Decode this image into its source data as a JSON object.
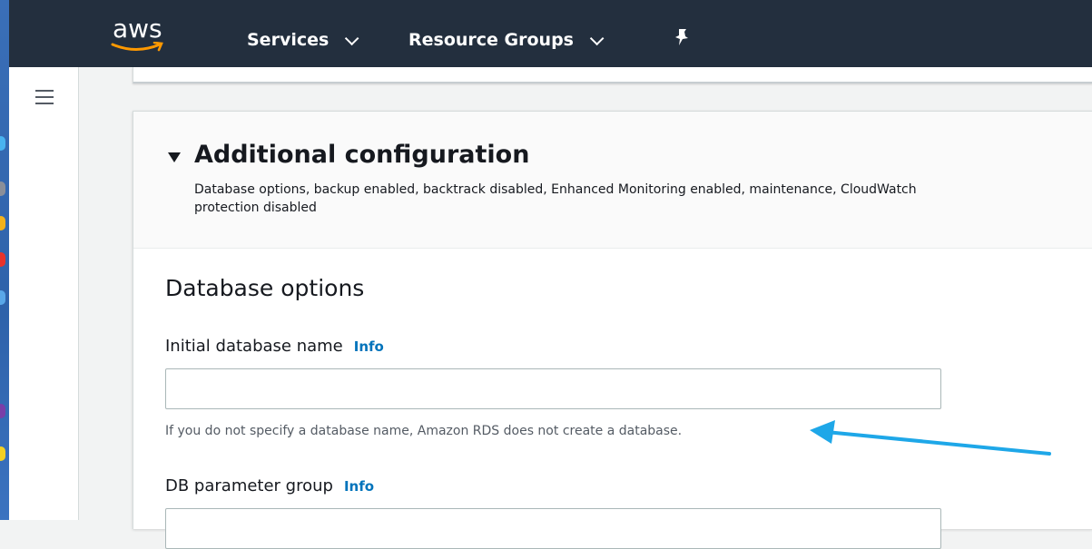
{
  "topnav": {
    "logo_text": "aws",
    "services_label": "Services",
    "resource_groups_label": "Resource Groups",
    "bg_color": "#232f3e"
  },
  "additional_config": {
    "title": "Additional configuration",
    "description_line1": "Database options, backup enabled, backtrack disabled, Enhanced Monitoring enabled, maintenance, CloudWatch",
    "description_line2": "protection disabled"
  },
  "database_options": {
    "title": "Database options",
    "initial_db_name": {
      "label": "Initial database name",
      "info_label": "Info",
      "value": "",
      "hint": "If you do not specify a database name, Amazon RDS does not create a database."
    },
    "db_parameter_group": {
      "label": "DB parameter group",
      "info_label": "Info"
    }
  },
  "colors": {
    "link": "#0073bb",
    "annotation_arrow": "#1ea7e8"
  }
}
